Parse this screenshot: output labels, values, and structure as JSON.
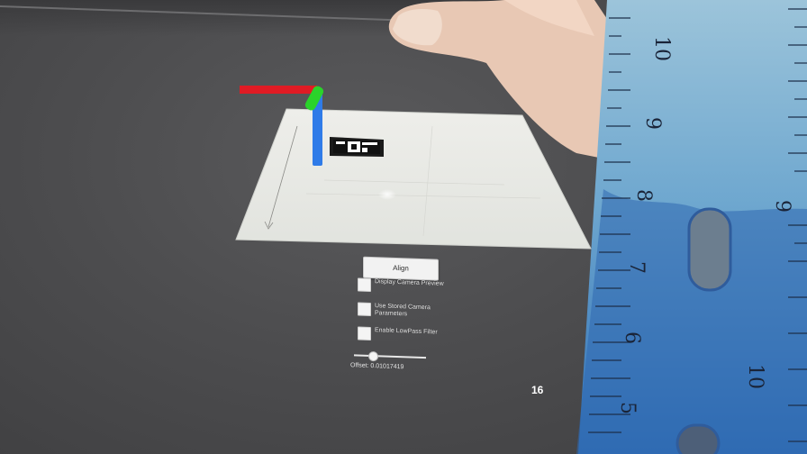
{
  "panel": {
    "align_label": "Align",
    "toggles": [
      {
        "label": "Display Camera Preview",
        "checked": false
      },
      {
        "label": "Use Stored Camera Parameters",
        "checked": false
      },
      {
        "label": "Enable LowPass Filter",
        "checked": false
      }
    ],
    "offset_label": "Offset: 0.01017419"
  },
  "counter": "16",
  "axes": {
    "x_color": "#e01b24",
    "y_color": "#2ad32a",
    "z_color": "#2f7be8"
  },
  "ruler": {
    "upper_numbers": [
      "10",
      "9",
      "8",
      "7",
      "6",
      "5"
    ],
    "lower_numbers": [
      "9",
      "10"
    ]
  },
  "icons": [
    "ar-marker-icon",
    "axis-gizmo-icon"
  ]
}
